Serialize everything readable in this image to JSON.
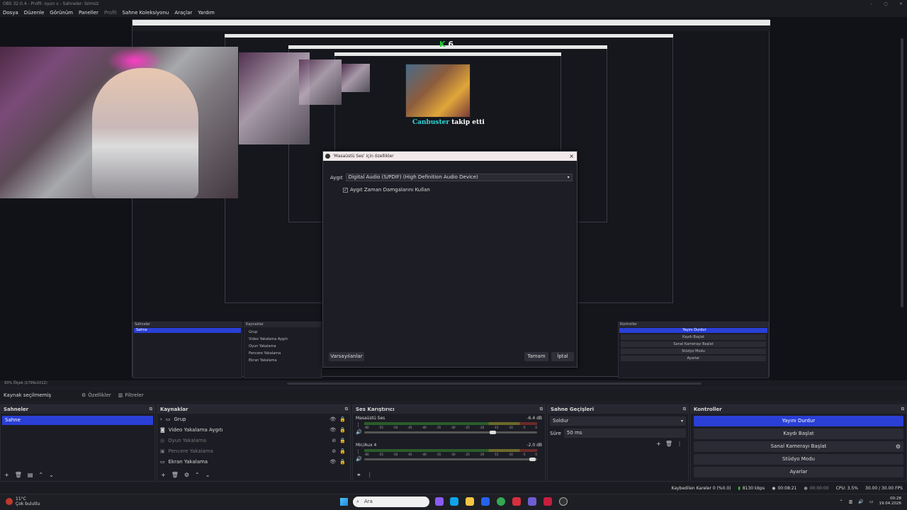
{
  "window": {
    "title": "OBS 32.0.4 - Profil: oyun v - Sahneler: İsimsiz"
  },
  "menu": [
    "Dosya",
    "Düzenle",
    "Görünüm",
    "Paneller",
    "Profil",
    "Sahne Koleksiyonu",
    "Araçlar",
    "Yardım"
  ],
  "preview": {
    "overlay_key": "K",
    "overlay_count": "6",
    "follower_name": "Canbuster",
    "follower_text": "takip etti"
  },
  "dialog": {
    "title": "'Masaüstü Ses' için özellikler",
    "device_label": "Aygıt",
    "device_value": "Digital Audio (S/PDIF) (High Definition Audio Device)",
    "checkbox_label": "Aygıt Zaman Damgalarını Kullan",
    "checkbox_checked": true,
    "defaults_button": "Varsayılanlar",
    "ok_button": "Tamam",
    "cancel_button": "İptal"
  },
  "zoom": {
    "text": "93%   Ölçek (1799x1012)"
  },
  "source_toolbar": {
    "no_source": "Kaynak seçilmemiş",
    "properties": "Özellikler",
    "filters": "Filtreler"
  },
  "scenes": {
    "title": "Sahneler",
    "items": [
      "Sahne"
    ]
  },
  "sources": {
    "title": "Kaynaklar",
    "items": [
      {
        "label": "Grup",
        "dim": false
      },
      {
        "label": "Video Yakalama Aygıtı",
        "dim": false
      },
      {
        "label": "Oyun Yakalama",
        "dim": true
      },
      {
        "label": "Pencere Yakalama",
        "dim": true
      },
      {
        "label": "Ekran Yakalama",
        "dim": false
      }
    ]
  },
  "mixer": {
    "title": "Ses Karıştırıcı",
    "ticks": [
      "-60",
      "-55",
      "-50",
      "-45",
      "-40",
      "-35",
      "-30",
      "-25",
      "-20",
      "-15",
      "-10",
      "-5",
      "0"
    ],
    "channels": [
      {
        "name": "Masaüstü Ses",
        "db": "-6.4 dB",
        "volume": 0.74
      },
      {
        "name": "Mic/Aux 4",
        "db": "-2.0 dB",
        "volume": 0.97
      }
    ]
  },
  "transitions": {
    "title": "Sahne Geçişleri",
    "type": "Soldur",
    "duration_label": "Süre",
    "duration_value": "50 ms"
  },
  "controls": {
    "title": "Kontroller",
    "items": [
      "Yayını Durdur",
      "Kaydı Başlat",
      "Sanal Kamerayı Başlat",
      "Stüdyo Modu",
      "Ayarlar"
    ]
  },
  "status": {
    "dropped": "Kaybedilen Kareler 0 (%0.0)",
    "bitrate": "8130 kbps",
    "stream_time": "00:08:21",
    "rec_time": "00:00:00",
    "cpu": "CPU: 3.5%",
    "fps": "30.00 / 30.00 FPS"
  },
  "taskbar": {
    "weather_temp": "11°C",
    "weather_text": "Çok bulutlu",
    "search_placeholder": "Ara",
    "time": "00:28",
    "date": "19.04.2026"
  },
  "colors": {
    "accent": "#2a3fd6",
    "panel": "#1c1d24",
    "background": "#1e1f26"
  }
}
